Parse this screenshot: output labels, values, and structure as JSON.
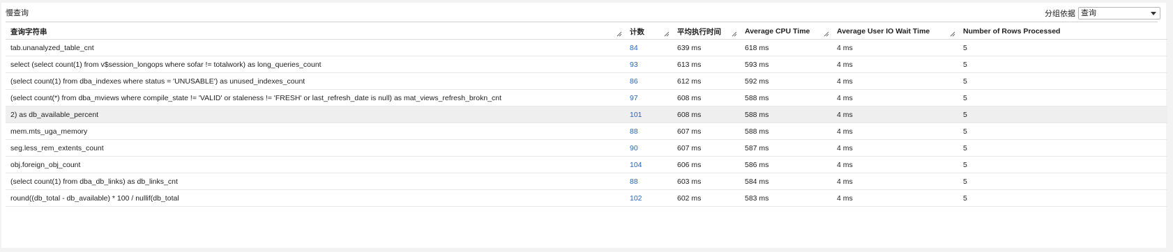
{
  "panel": {
    "title": "慢查询",
    "group_by_label": "分组依据",
    "group_by_value": "查询"
  },
  "table": {
    "columns": [
      "查询字符串",
      "计数",
      "平均执行时间",
      "Average CPU Time",
      "Average User IO Wait Time",
      "Number of Rows Processed"
    ],
    "rows": [
      [
        "tab.unanalyzed_table_cnt",
        "84",
        "639 ms",
        "618 ms",
        "4 ms",
        "5"
      ],
      [
        "select (select count(1) from v$session_longops where sofar != totalwork) as long_queries_count",
        "93",
        "613 ms",
        "593 ms",
        "4 ms",
        "5"
      ],
      [
        "(select count(1) from dba_indexes where status = 'UNUSABLE') as unused_indexes_count",
        "86",
        "612 ms",
        "592 ms",
        "4 ms",
        "5"
      ],
      [
        "(select count(*) from dba_mviews where compile_state != 'VALID' or staleness != 'FRESH' or last_refresh_date is null) as mat_views_refresh_brokn_cnt",
        "97",
        "608 ms",
        "588 ms",
        "4 ms",
        "5"
      ],
      [
        "2) as db_available_percent",
        "101",
        "608 ms",
        "588 ms",
        "4 ms",
        "5"
      ],
      [
        "mem.mts_uga_memory",
        "88",
        "607 ms",
        "588 ms",
        "4 ms",
        "5"
      ],
      [
        "seg.less_rem_extents_count",
        "90",
        "607 ms",
        "587 ms",
        "4 ms",
        "5"
      ],
      [
        "obj.foreign_obj_count",
        "104",
        "606 ms",
        "586 ms",
        "4 ms",
        "5"
      ],
      [
        "(select count(1) from dba_db_links) as db_links_cnt",
        "88",
        "603 ms",
        "584 ms",
        "4 ms",
        "5"
      ],
      [
        "round((db_total - db_available) * 100 / nullif(db_total",
        "102",
        "602 ms",
        "583 ms",
        "4 ms",
        "5"
      ]
    ]
  },
  "colors": {
    "link": "#2862c4",
    "highlight_row": "#efefef"
  },
  "icons": {
    "dropdown": "chevron-down-icon",
    "column_resize": "resize-handle-icon"
  }
}
